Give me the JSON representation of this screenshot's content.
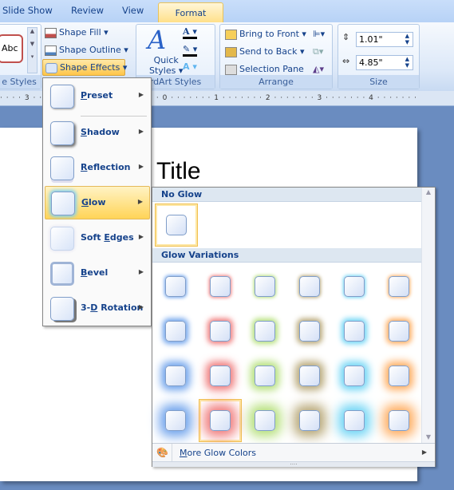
{
  "tabs": [
    {
      "label": "Slide Show"
    },
    {
      "label": "Review"
    },
    {
      "label": "View"
    },
    {
      "label": "Format",
      "active": true
    }
  ],
  "ribbon": {
    "shape_styles": {
      "label": "e Styles",
      "preview_text": "Abc",
      "fill": "Shape Fill",
      "outline": "Shape Outline",
      "effects": "Shape Effects"
    },
    "wordart": {
      "label": "rdArt Styles",
      "quick_styles": "Quick",
      "quick_styles2": "Styles"
    },
    "arrange": {
      "label": "Arrange",
      "bring_front": "Bring to Front",
      "send_back": "Send to Back",
      "selection_pane": "Selection Pane"
    },
    "size": {
      "label": "Size",
      "height": "1.01\"",
      "width": "4.85\""
    }
  },
  "ruler": "· · · · 3 · · · · · · · · · · · · · · · · · · · · · 0 · · · · · · · 1 · · · · · · · 2 · · · · · · · 3 · · · · · · · 4 · · · · · · ·",
  "slide": {
    "title": "Title"
  },
  "menu": {
    "items": [
      {
        "pre": "",
        "u": "P",
        "post": "reset"
      },
      {
        "pre": "",
        "u": "S",
        "post": "hadow"
      },
      {
        "pre": "",
        "u": "R",
        "post": "eflection"
      },
      {
        "pre": "",
        "u": "G",
        "post": "low",
        "selected": true
      },
      {
        "pre": "Soft ",
        "u": "E",
        "post": "dges"
      },
      {
        "pre": "",
        "u": "B",
        "post": "evel"
      },
      {
        "pre": "3-",
        "u": "D",
        "post": " Rotation"
      }
    ]
  },
  "gallery": {
    "no_glow_header": "No Glow",
    "variations_header": "Glow Variations",
    "glow_colors": [
      "#6fa3ec",
      "#f07c7c",
      "#b6e07c",
      "#b8a878",
      "#6fd5f5",
      "#ffae62"
    ],
    "glow_sizes_pt": [
      5,
      8,
      11,
      18
    ],
    "selected": {
      "row": 3,
      "col": 1
    },
    "more": {
      "u": "M",
      "post": "ore Glow Colors"
    }
  }
}
